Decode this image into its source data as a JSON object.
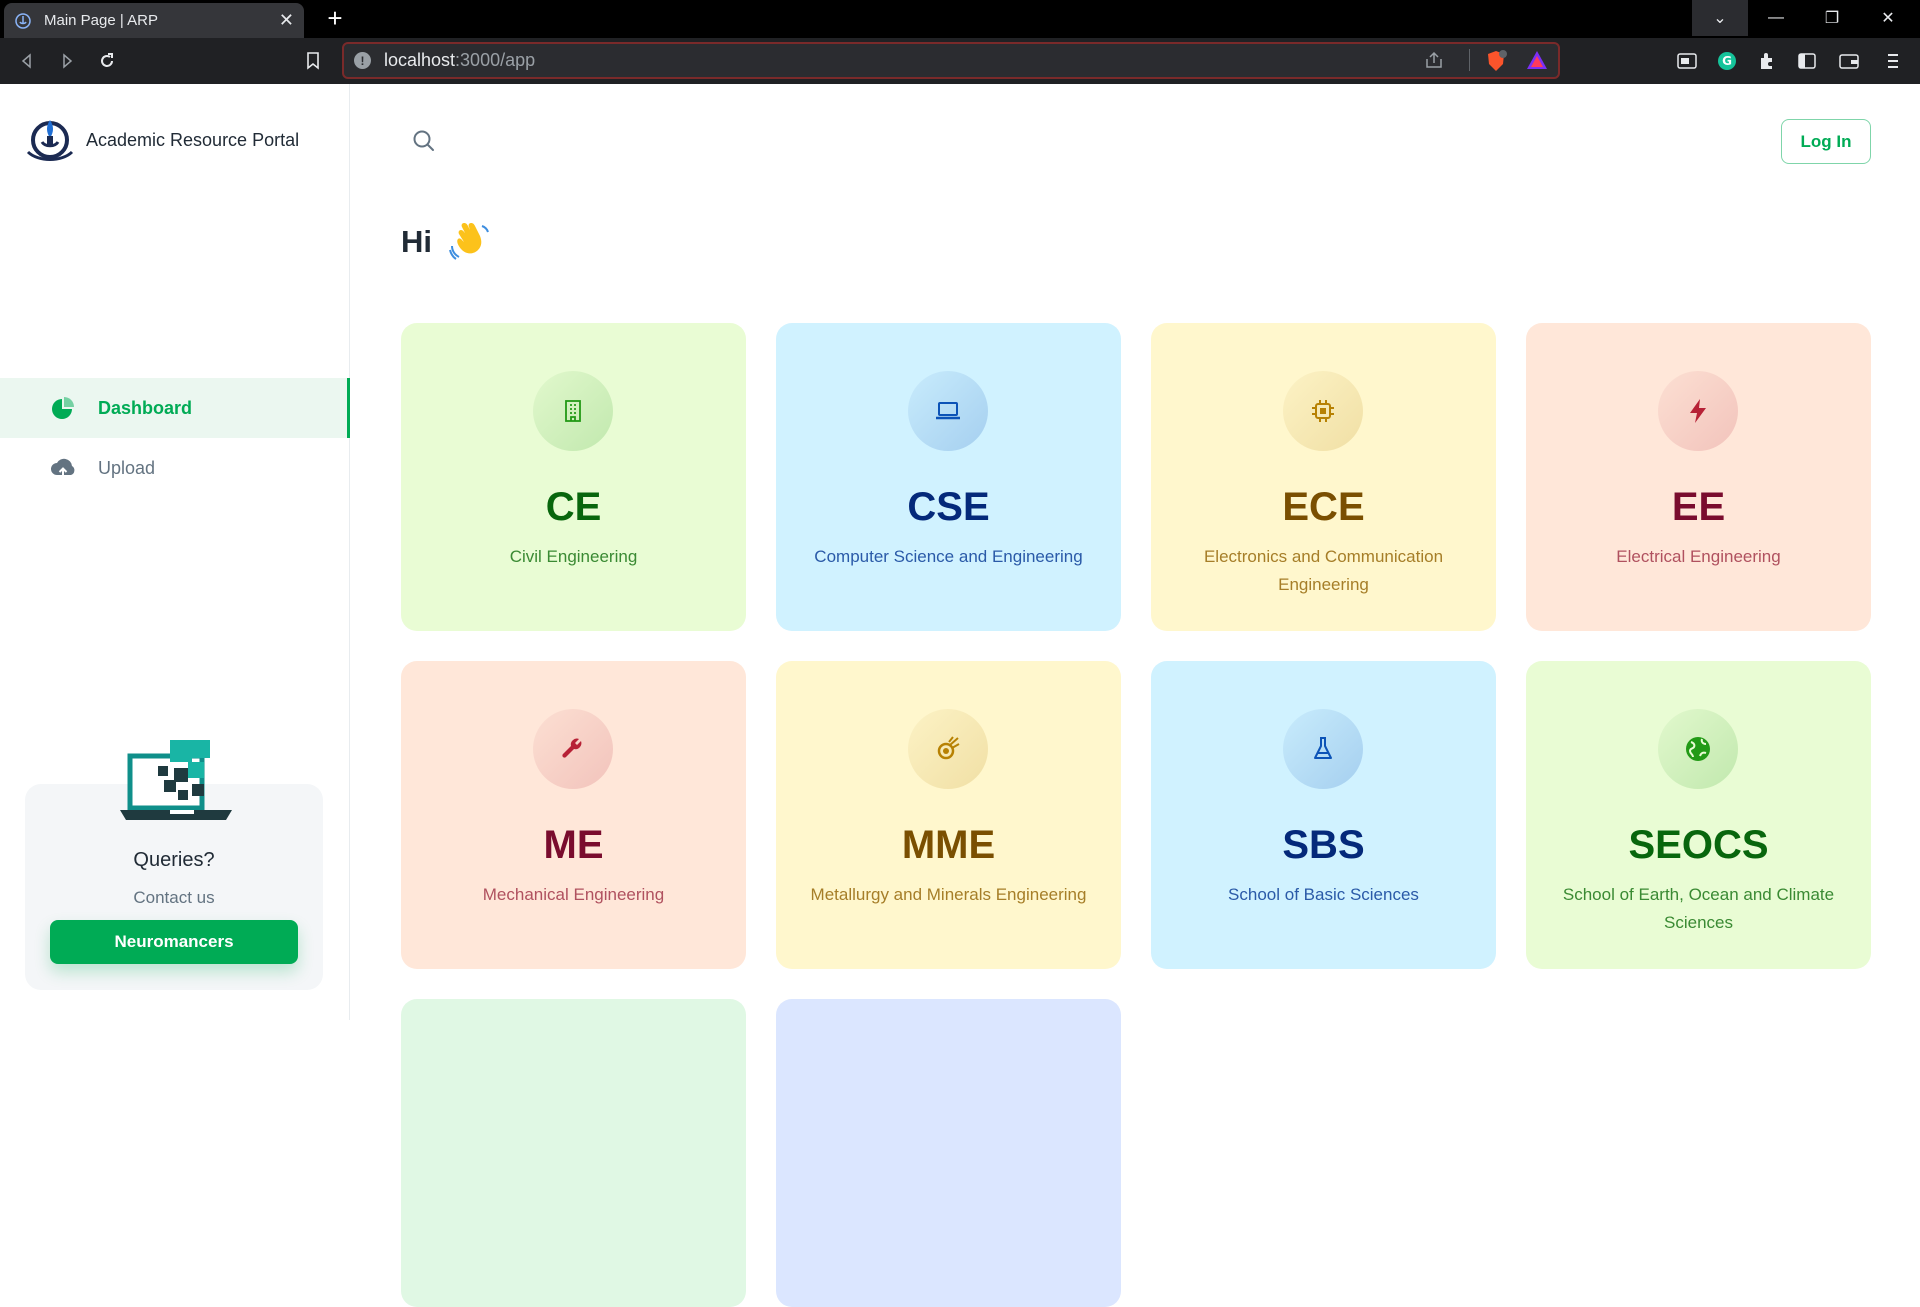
{
  "browser": {
    "tab_title": "Main Page | ARP",
    "url_host": "localhost",
    "url_path": ":3000/app"
  },
  "sidebar": {
    "brand": "Academic Resource Portal",
    "items": [
      {
        "label": "Dashboard",
        "icon": "pie-chart-icon",
        "active": true
      },
      {
        "label": "Upload",
        "icon": "cloud-upload-icon",
        "active": false
      }
    ],
    "help": {
      "title": "Queries?",
      "subtitle": "Contact us",
      "button": "Neuromancers"
    }
  },
  "header": {
    "login_label": "Log In"
  },
  "greeting": "Hi",
  "departments": [
    {
      "abbr": "CE",
      "name": "Civil Engineering",
      "icon": "building-icon",
      "color": "green"
    },
    {
      "abbr": "CSE",
      "name": "Computer Science and Engineering",
      "icon": "laptop-icon",
      "color": "blue"
    },
    {
      "abbr": "ECE",
      "name": "Electronics and Communication Engineering",
      "icon": "chip-icon",
      "color": "yellow"
    },
    {
      "abbr": "EE",
      "name": "Electrical Engineering",
      "icon": "lightning-icon",
      "color": "red"
    },
    {
      "abbr": "ME",
      "name": "Mechanical Engineering",
      "icon": "wrench-icon",
      "color": "red"
    },
    {
      "abbr": "MME",
      "name": "Metallurgy and Minerals Engineering",
      "icon": "fire-icon",
      "color": "yellow"
    },
    {
      "abbr": "SBS",
      "name": "School of Basic Sciences",
      "icon": "flask-icon",
      "color": "blue"
    },
    {
      "abbr": "SEOCS",
      "name": "School of Earth, Ocean and Climate Sciences",
      "icon": "globe-icon",
      "color": "green"
    }
  ],
  "colors": {
    "primary": "#00ab55",
    "green_card": "#e9fcd4",
    "blue_card": "#d0f2ff",
    "yellow_card": "#fff7cd",
    "red_card": "#ffe7d9"
  }
}
